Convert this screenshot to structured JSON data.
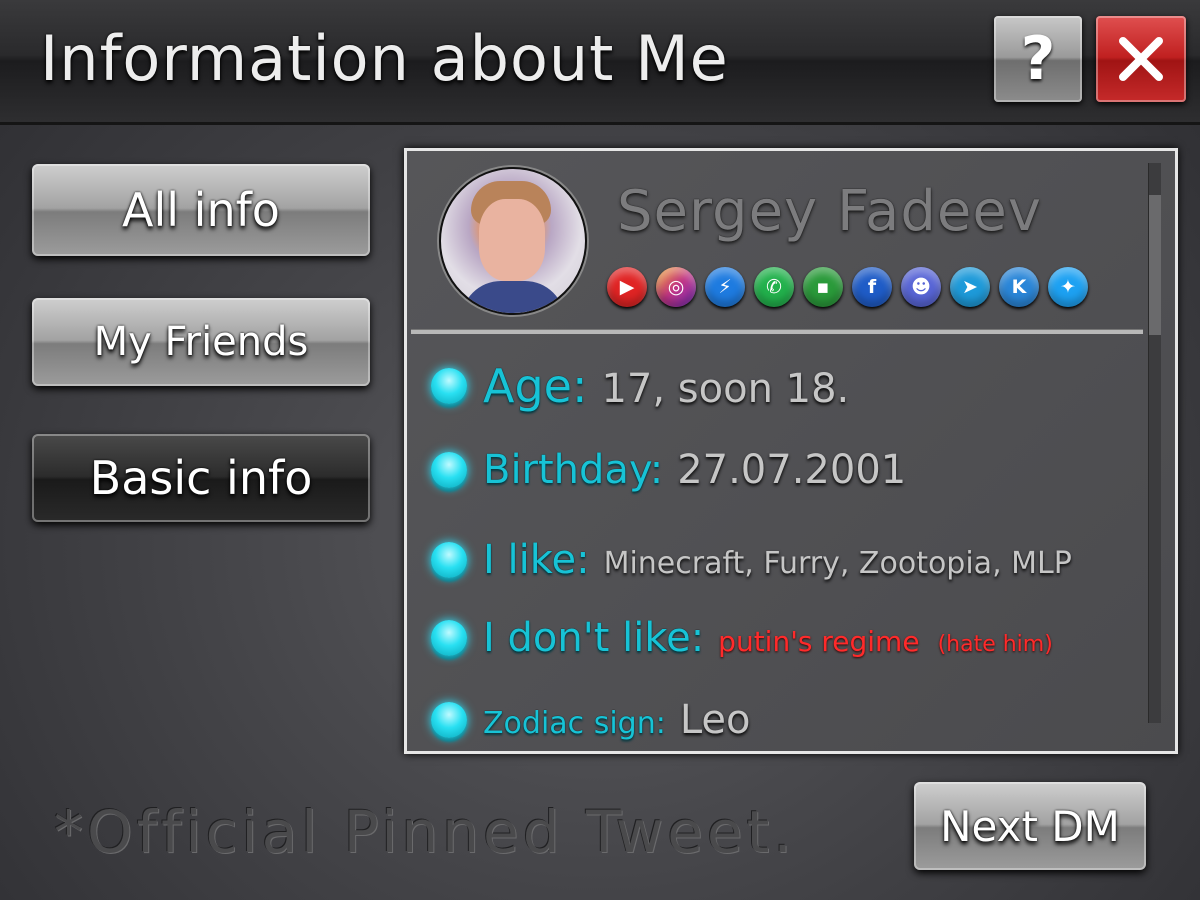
{
  "window": {
    "title": "Information about Me",
    "help_label": "?",
    "close_icon": "close-icon"
  },
  "sidebar": {
    "items": [
      {
        "label": "All info",
        "active": false
      },
      {
        "label": "My Friends",
        "active": false
      },
      {
        "label": "Basic info",
        "active": true
      }
    ]
  },
  "profile": {
    "name": "Sergey Fadeev",
    "socials": [
      {
        "icon": "youtube-icon",
        "glyph": "▶",
        "color": "#e02424"
      },
      {
        "icon": "instagram-icon",
        "glyph": "◎",
        "color": "#c13584"
      },
      {
        "icon": "messenger-icon",
        "glyph": "⚡",
        "color": "#1e7be0"
      },
      {
        "icon": "whatsapp-icon",
        "glyph": "✆",
        "color": "#22b14c"
      },
      {
        "icon": "odnoklassniki-icon",
        "glyph": "▪",
        "color": "#2a9a3a"
      },
      {
        "icon": "facebook-icon",
        "glyph": "f",
        "color": "#1f5cc7"
      },
      {
        "icon": "discord-icon",
        "glyph": "☻",
        "color": "#5865d6"
      },
      {
        "icon": "telegram-icon",
        "glyph": "➤",
        "color": "#1e9ad9"
      },
      {
        "icon": "vk-icon",
        "glyph": "K",
        "color": "#2a86d8"
      },
      {
        "icon": "twitter-icon",
        "glyph": "✦",
        "color": "#1da1f2"
      }
    ]
  },
  "info": {
    "age_label": "Age:",
    "age_value": "17, soon 18.",
    "birthday_label": "Birthday:",
    "birthday_value": "27.07.2001",
    "likes_label": "I like:",
    "likes_value": "Minecraft, Furry, Zootopia, MLP",
    "dislikes_label": "I don't like:",
    "dislikes_value": "putin's regime",
    "dislikes_note": "(hate him)",
    "zodiac_label": "Zodiac sign:",
    "zodiac_value": "Leo"
  },
  "footer": {
    "note": "*Official Pinned Tweet.",
    "next_button": "Next DM"
  },
  "colors": {
    "accent_cyan": "#17c3d6",
    "danger_red": "#ff2a2a"
  }
}
